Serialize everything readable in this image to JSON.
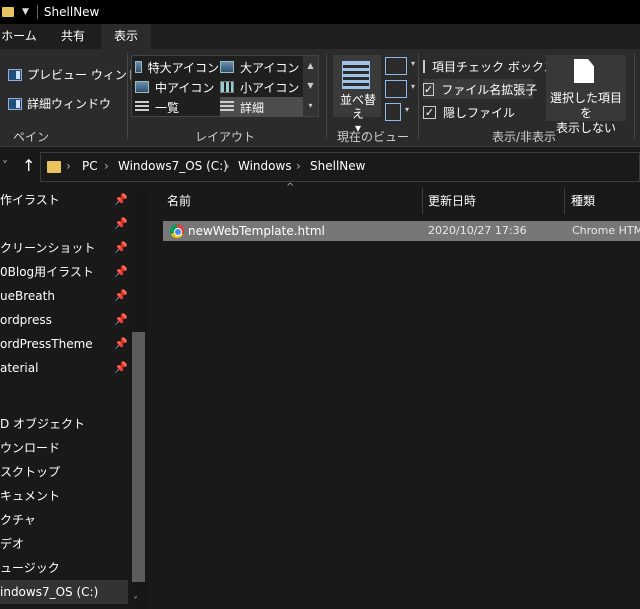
{
  "window": {
    "title": "ShellNew"
  },
  "tabs": [
    {
      "label": "ホーム",
      "active": false
    },
    {
      "label": "共有",
      "active": false
    },
    {
      "label": "表示",
      "active": true
    }
  ],
  "ribbon": {
    "pane_group": {
      "preview_label": "プレビュー ウィンドウ",
      "details_label": "詳細ウィンドウ",
      "group_label": "ペイン"
    },
    "layout_group": {
      "items": [
        {
          "label": "特大アイコン"
        },
        {
          "label": "大アイコン"
        },
        {
          "label": "中アイコン"
        },
        {
          "label": "小アイコン"
        },
        {
          "label": "一覧"
        },
        {
          "label": "詳細",
          "selected": true
        }
      ],
      "group_label": "レイアウト"
    },
    "view_group": {
      "sort_label": "並べ替え",
      "group_label": "現在のビュー"
    },
    "showhide_group": {
      "checkboxes": [
        {
          "label": "項目チェック ボックス",
          "checked": false
        },
        {
          "label": "ファイル名拡張子",
          "checked": true
        },
        {
          "label": "隠しファイル",
          "checked": true
        }
      ],
      "hide_selected_label_1": "選択した項目を",
      "hide_selected_label_2": "表示しない",
      "group_label": "表示/非表示"
    }
  },
  "address": {
    "crumbs": [
      "PC",
      "Windows7_OS (C:)",
      "Windows",
      "ShellNew"
    ]
  },
  "navpane": {
    "items": [
      {
        "label": "作イラスト",
        "pinned": true
      },
      {
        "label": "",
        "pinned": true
      },
      {
        "label": "クリーンショット",
        "pinned": true
      },
      {
        "label": "0Blog用イラスト",
        "pinned": true
      },
      {
        "label": "ueBreath",
        "pinned": true
      },
      {
        "label": "ordpress",
        "pinned": true
      },
      {
        "label": "ordPressTheme",
        "pinned": true
      },
      {
        "label": "aterial",
        "pinned": true
      },
      {
        "label": "",
        "pinned": false
      },
      {
        "label": "D オブジェクト",
        "pinned": false
      },
      {
        "label": "ウンロード",
        "pinned": false
      },
      {
        "label": "スクトップ",
        "pinned": false
      },
      {
        "label": "キュメント",
        "pinned": false
      },
      {
        "label": "クチャ",
        "pinned": false
      },
      {
        "label": "デオ",
        "pinned": false
      },
      {
        "label": "ュージック",
        "pinned": false
      },
      {
        "label": "indows7_OS (C:)",
        "pinned": false,
        "selected": true
      }
    ]
  },
  "content": {
    "columns": [
      "名前",
      "更新日時",
      "種類"
    ],
    "files": [
      {
        "name": "newWebTemplate.html",
        "modified": "2020/10/27 17:36",
        "type": "Chrome HTM",
        "icon": "chrome-icon"
      }
    ]
  },
  "colors": {
    "background": "#191919",
    "ribbon": "#2b2b2b",
    "selection": "#777777",
    "folder": "#e8c35e"
  }
}
